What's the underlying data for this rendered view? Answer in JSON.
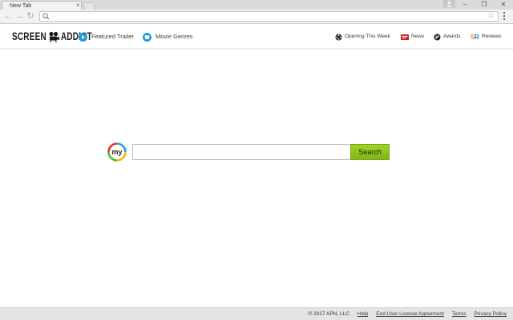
{
  "browser": {
    "tab_title": "New Tab",
    "tab_close": "×",
    "omnibox_value": "",
    "window_controls": [
      "–",
      "❐",
      "✕"
    ]
  },
  "site": {
    "logo_left": "SCREEN",
    "logo_right": "ADDICT",
    "nav_left": [
      {
        "label": "Featured Trailer",
        "icon": "play-icon"
      },
      {
        "label": "Movie Genres",
        "icon": "genres-icon"
      }
    ],
    "nav_right": [
      {
        "label": "Opening This Week",
        "icon": "film-reel-icon"
      },
      {
        "label": "News",
        "icon": "news-icon"
      },
      {
        "label": "Awards",
        "icon": "awards-icon"
      },
      {
        "label": "Reviews",
        "icon": "reviews-icon"
      }
    ]
  },
  "search": {
    "logo_text": "my",
    "placeholder": "",
    "value": "",
    "button_label": "Search"
  },
  "footer": {
    "copyright": "© 2017 APN, LLC",
    "links": [
      "Help",
      "End User License Agreement",
      "Terms",
      "Privacy Policy"
    ]
  },
  "colors": {
    "accent_blue": "#1a9ad6",
    "search_green": "#8cc21f",
    "news_red": "#cc1f1f",
    "reviews_orange": "#f08a1c"
  }
}
